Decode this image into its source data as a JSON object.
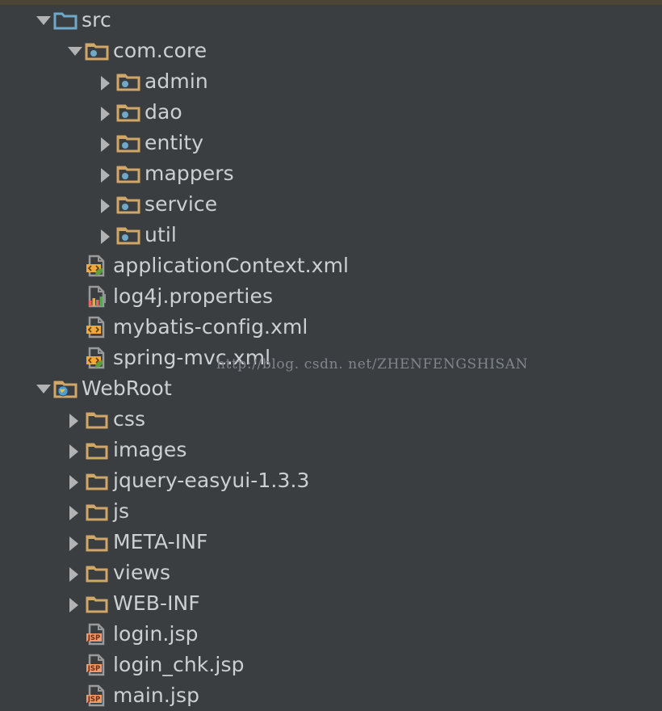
{
  "window": {
    "title": "Project Explorer Tree",
    "background_color": "#3a3e41",
    "top_strip_color": "#4b4537",
    "text_color": "#ccd0d2",
    "twisty_color": "#b2b2b2"
  },
  "colors": {
    "source_folder": "#6fa8c9",
    "package_folder": "#d0a766",
    "plain_folder": "#d0a766",
    "package_dot": "#6fa8c9",
    "xml_badge": "#f0a93b",
    "spring_leaf": "#5e9e3e",
    "jsp_badge": "#f4996b",
    "page_gray": "#9a9a9a",
    "props_bar_red": "#e8685a",
    "props_bar_orange": "#f0a93b",
    "props_bar_green": "#4eae4e",
    "globe_blue": "#4f9fd4",
    "globe_yellow": "#f0c040"
  },
  "watermark": "http://blog. csdn. net/ZHENFENGSHISAN",
  "tree": [
    {
      "label": "src",
      "level": 0,
      "twisty": "down",
      "icon": "source-folder-icon"
    },
    {
      "label": "com.core",
      "level": 1,
      "twisty": "down",
      "icon": "package-folder-icon"
    },
    {
      "label": "admin",
      "level": 2,
      "twisty": "right",
      "icon": "package-folder-icon"
    },
    {
      "label": "dao",
      "level": 2,
      "twisty": "right",
      "icon": "package-folder-icon"
    },
    {
      "label": "entity",
      "level": 2,
      "twisty": "right",
      "icon": "package-folder-icon"
    },
    {
      "label": "mappers",
      "level": 2,
      "twisty": "right",
      "icon": "package-folder-icon"
    },
    {
      "label": "service",
      "level": 2,
      "twisty": "right",
      "icon": "package-folder-icon"
    },
    {
      "label": "util",
      "level": 2,
      "twisty": "right",
      "icon": "package-folder-icon"
    },
    {
      "label": "applicationContext.xml",
      "level": 1,
      "twisty": "none",
      "icon": "spring-xml-file-icon"
    },
    {
      "label": "log4j.properties",
      "level": 1,
      "twisty": "none",
      "icon": "properties-file-icon"
    },
    {
      "label": "mybatis-config.xml",
      "level": 1,
      "twisty": "none",
      "icon": "xml-file-icon"
    },
    {
      "label": "spring-mvc.xml",
      "level": 1,
      "twisty": "none",
      "icon": "spring-xml-file-icon"
    },
    {
      "label": "WebRoot",
      "level": 0,
      "twisty": "down",
      "icon": "webroot-folder-icon"
    },
    {
      "label": "css",
      "level": 1,
      "twisty": "right",
      "icon": "plain-folder-icon"
    },
    {
      "label": "images",
      "level": 1,
      "twisty": "right",
      "icon": "plain-folder-icon"
    },
    {
      "label": "jquery-easyui-1.3.3",
      "level": 1,
      "twisty": "right",
      "icon": "plain-folder-icon"
    },
    {
      "label": "js",
      "level": 1,
      "twisty": "right",
      "icon": "plain-folder-icon"
    },
    {
      "label": "META-INF",
      "level": 1,
      "twisty": "right",
      "icon": "plain-folder-icon"
    },
    {
      "label": "views",
      "level": 1,
      "twisty": "right",
      "icon": "plain-folder-icon"
    },
    {
      "label": "WEB-INF",
      "level": 1,
      "twisty": "right",
      "icon": "plain-folder-icon"
    },
    {
      "label": "login.jsp",
      "level": 1,
      "twisty": "none",
      "icon": "jsp-file-icon"
    },
    {
      "label": "login_chk.jsp",
      "level": 1,
      "twisty": "none",
      "icon": "jsp-file-icon"
    },
    {
      "label": "main.jsp",
      "level": 1,
      "twisty": "none",
      "icon": "jsp-file-icon"
    }
  ]
}
